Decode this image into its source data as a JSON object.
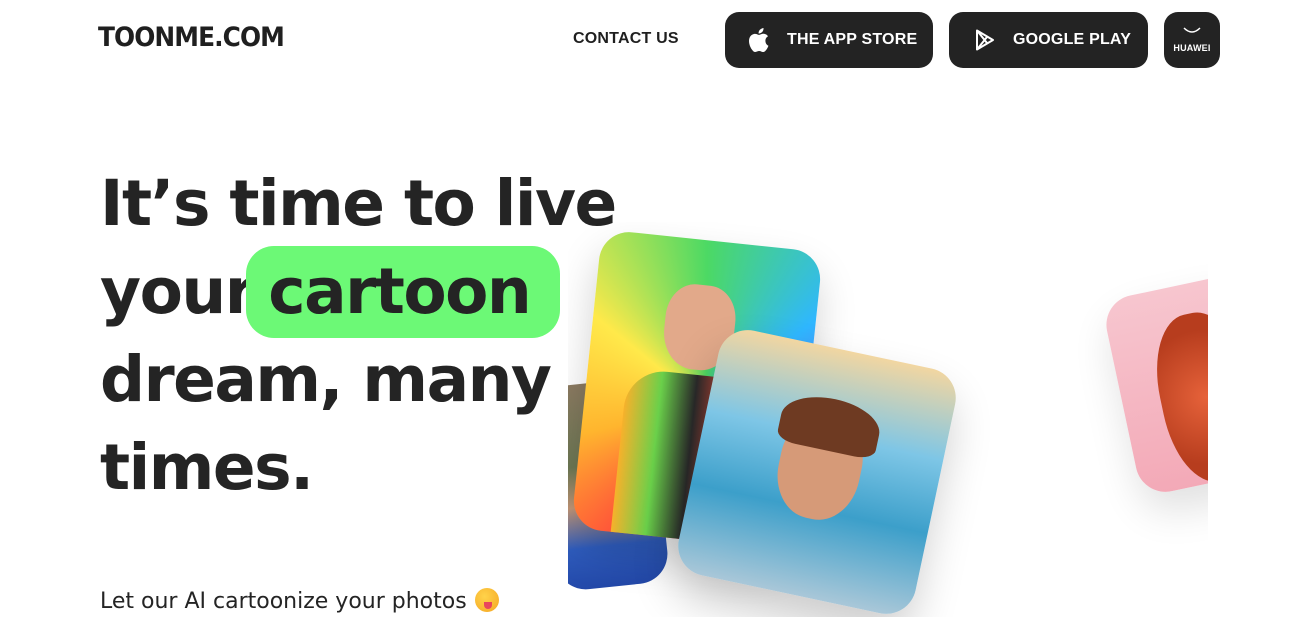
{
  "header": {
    "logo": "TOONME.COM",
    "contact": "CONTACT US",
    "app_store": "THE APP STORE",
    "google_play": "GOOGLE PLAY",
    "huawei": "HUAWEI"
  },
  "hero": {
    "line1": "It’s time to live",
    "line2_prefix": "your",
    "highlight": "cartoon",
    "line3": "dream, many",
    "line4": "times.",
    "subtitle": "Let our AI cartoonize your photos",
    "highlight_color": "#6cf976"
  },
  "colors": {
    "button_bg": "#232323",
    "text": "#242424"
  },
  "icons": [
    "apple-icon",
    "google-play-icon",
    "huawei-icon",
    "tongue-emoji-icon"
  ]
}
